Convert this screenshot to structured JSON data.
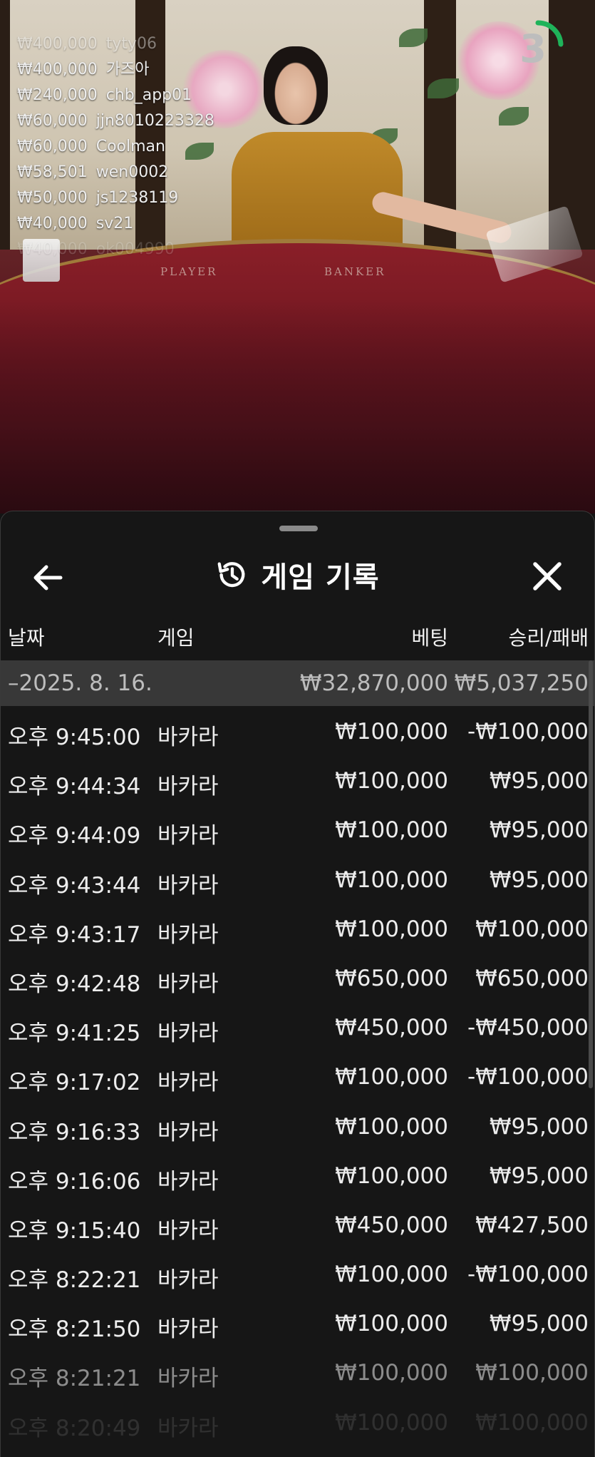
{
  "bet_feed": [
    {
      "amount": "₩400,000",
      "user": "tyty06"
    },
    {
      "amount": "₩400,000",
      "user": "가즈아"
    },
    {
      "amount": "₩240,000",
      "user": "chb_app01"
    },
    {
      "amount": "₩60,000",
      "user": "jjn8010223328"
    },
    {
      "amount": "₩60,000",
      "user": "Coolman"
    },
    {
      "amount": "₩58,501",
      "user": "wen0002"
    },
    {
      "amount": "₩50,000",
      "user": "js1238119"
    },
    {
      "amount": "₩40,000",
      "user": "sv21"
    },
    {
      "amount": "₩40,000",
      "user": "ok004990"
    }
  ],
  "table_labels": {
    "player": "PLAYER",
    "banker": "BANKER"
  },
  "countdown": {
    "value": "3"
  },
  "sheet": {
    "title": "게임 기록",
    "icons": {
      "back": "arrow-left-icon",
      "history": "history-clock-icon",
      "close": "close-x-icon"
    },
    "columns": {
      "date": "날짜",
      "game": "게임",
      "bet": "베팅",
      "win_loss": "승리/패배"
    },
    "date_group": {
      "date": "–2025. 8. 16.",
      "bet_total": "₩32,870,000",
      "win_total": "₩5,037,250"
    },
    "rows": [
      {
        "time": "오후 9:45:00",
        "game": "바카라",
        "bet": "₩100,000",
        "result": "-₩100,000"
      },
      {
        "time": "오후 9:44:34",
        "game": "바카라",
        "bet": "₩100,000",
        "result": "₩95,000"
      },
      {
        "time": "오후 9:44:09",
        "game": "바카라",
        "bet": "₩100,000",
        "result": "₩95,000"
      },
      {
        "time": "오후 9:43:44",
        "game": "바카라",
        "bet": "₩100,000",
        "result": "₩95,000"
      },
      {
        "time": "오후 9:43:17",
        "game": "바카라",
        "bet": "₩100,000",
        "result": "₩100,000"
      },
      {
        "time": "오후 9:42:48",
        "game": "바카라",
        "bet": "₩650,000",
        "result": "₩650,000"
      },
      {
        "time": "오후 9:41:25",
        "game": "바카라",
        "bet": "₩450,000",
        "result": "-₩450,000"
      },
      {
        "time": "오후 9:17:02",
        "game": "바카라",
        "bet": "₩100,000",
        "result": "-₩100,000"
      },
      {
        "time": "오후 9:16:33",
        "game": "바카라",
        "bet": "₩100,000",
        "result": "₩95,000"
      },
      {
        "time": "오후 9:16:06",
        "game": "바카라",
        "bet": "₩100,000",
        "result": "₩95,000"
      },
      {
        "time": "오후 9:15:40",
        "game": "바카라",
        "bet": "₩450,000",
        "result": "₩427,500"
      },
      {
        "time": "오후 8:22:21",
        "game": "바카라",
        "bet": "₩100,000",
        "result": "-₩100,000"
      },
      {
        "time": "오후 8:21:50",
        "game": "바카라",
        "bet": "₩100,000",
        "result": "₩95,000"
      },
      {
        "time": "오후 8:21:21",
        "game": "바카라",
        "bet": "₩100,000",
        "result": "₩100,000"
      },
      {
        "time": "오후 8:20:49",
        "game": "바카라",
        "bet": "₩100,000",
        "result": "₩100,000"
      }
    ]
  }
}
